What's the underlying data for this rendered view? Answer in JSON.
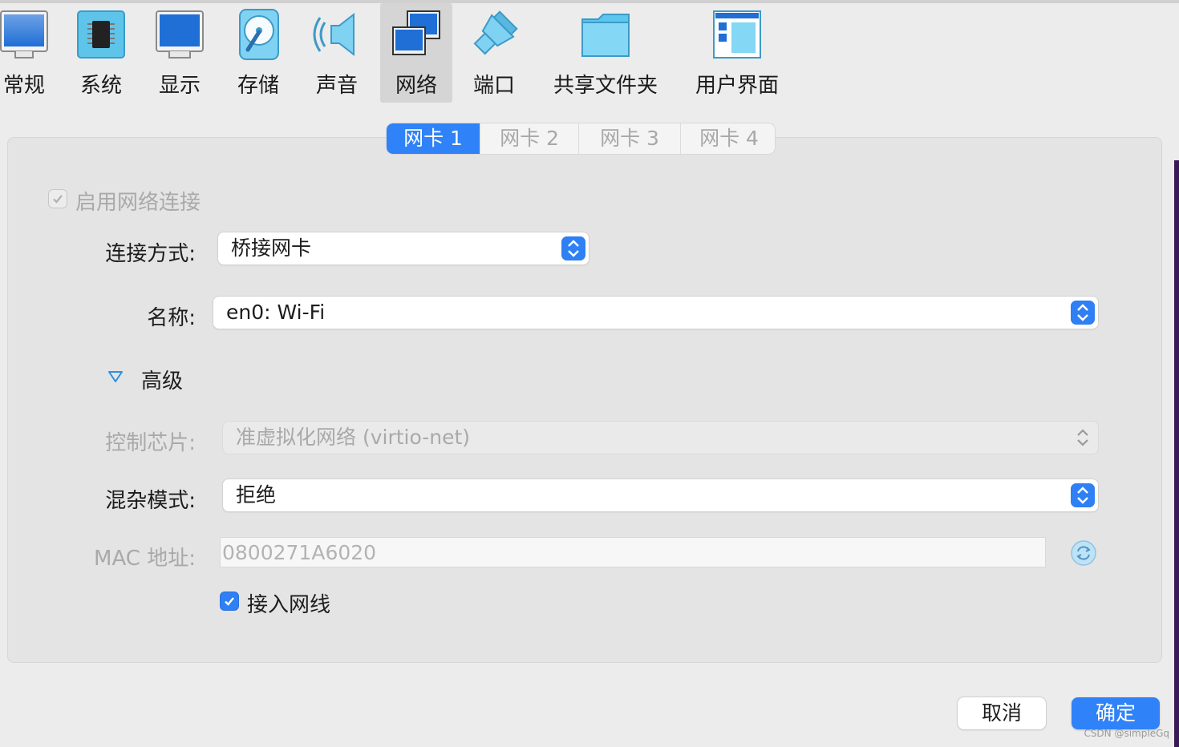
{
  "toolbar": {
    "items": [
      {
        "label": "常规",
        "icon": "monitor-general-icon"
      },
      {
        "label": "系统",
        "icon": "chip-icon"
      },
      {
        "label": "显示",
        "icon": "display-icon"
      },
      {
        "label": "存储",
        "icon": "disk-icon"
      },
      {
        "label": "声音",
        "icon": "speaker-icon"
      },
      {
        "label": "网络",
        "icon": "network-icon",
        "selected": true
      },
      {
        "label": "端口",
        "icon": "serial-port-icon"
      },
      {
        "label": "共享文件夹",
        "icon": "shared-folder-icon"
      },
      {
        "label": "用户界面",
        "icon": "user-interface-icon"
      }
    ]
  },
  "tabs": [
    {
      "label": "网卡 1",
      "active": true
    },
    {
      "label": "网卡 2"
    },
    {
      "label": "网卡 3"
    },
    {
      "label": "网卡 4"
    }
  ],
  "form": {
    "enable_network": {
      "label": "启用网络连接",
      "checked": true,
      "disabled": true
    },
    "attached_to": {
      "label": "连接方式:",
      "value": "桥接网卡"
    },
    "name": {
      "label": "名称:",
      "value": "en0: Wi-Fi"
    },
    "advanced": {
      "label": "高级",
      "expanded": true
    },
    "adapter_type": {
      "label": "控制芯片:",
      "value": "准虚拟化网络 (virtio-net)",
      "disabled": true
    },
    "promiscuous": {
      "label": "混杂模式:",
      "value": "拒绝"
    },
    "mac": {
      "label": "MAC 地址:",
      "value": "0800271A6020",
      "disabled": true
    },
    "cable_connected": {
      "label": "接入网线",
      "checked": true
    }
  },
  "buttons": {
    "cancel": "取消",
    "ok": "确定"
  },
  "watermark": "CSDN @simpleGq",
  "colors": {
    "accent": "#2f7ff5",
    "disabled_text": "#a9a9a9"
  }
}
